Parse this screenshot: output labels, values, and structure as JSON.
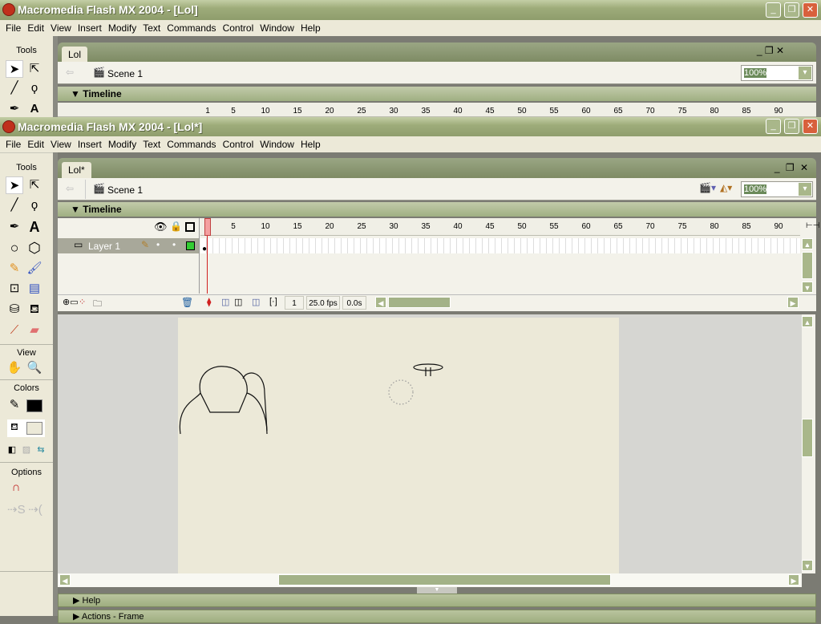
{
  "back_window": {
    "title": "Macromedia Flash MX 2004 - [Lol]",
    "doc_tab": "Lol",
    "scene": "Scene 1",
    "timeline": "Timeline",
    "zoom": "100%"
  },
  "window": {
    "title": "Macromedia Flash MX 2004 - [Lol*]",
    "controls": {
      "minimize": "_",
      "restore": "❐",
      "close": "✕"
    }
  },
  "menu": [
    "File",
    "Edit",
    "View",
    "Insert",
    "Modify",
    "Text",
    "Commands",
    "Control",
    "Window",
    "Help"
  ],
  "tools": {
    "title": "Tools",
    "view_title": "View",
    "colors_title": "Colors",
    "options_title": "Options",
    "stroke_color": "#000000",
    "fill_color": "#ece9d8"
  },
  "document": {
    "tab": "Lol*",
    "scene": "Scene 1",
    "zoom": "100%"
  },
  "timeline": {
    "title": "Timeline",
    "ruler_labels": [
      "1",
      "5",
      "10",
      "15",
      "20",
      "25",
      "30",
      "35",
      "40",
      "45",
      "50",
      "55",
      "60",
      "65",
      "70",
      "75",
      "80",
      "85",
      "90"
    ],
    "layers": [
      {
        "name": "Layer 1",
        "color": "#33cc33"
      }
    ],
    "current_frame": "1",
    "fps": "25.0 fps",
    "elapsed": "0.0s"
  },
  "panels": [
    {
      "label": "Help"
    },
    {
      "label": "Actions - Frame"
    }
  ]
}
